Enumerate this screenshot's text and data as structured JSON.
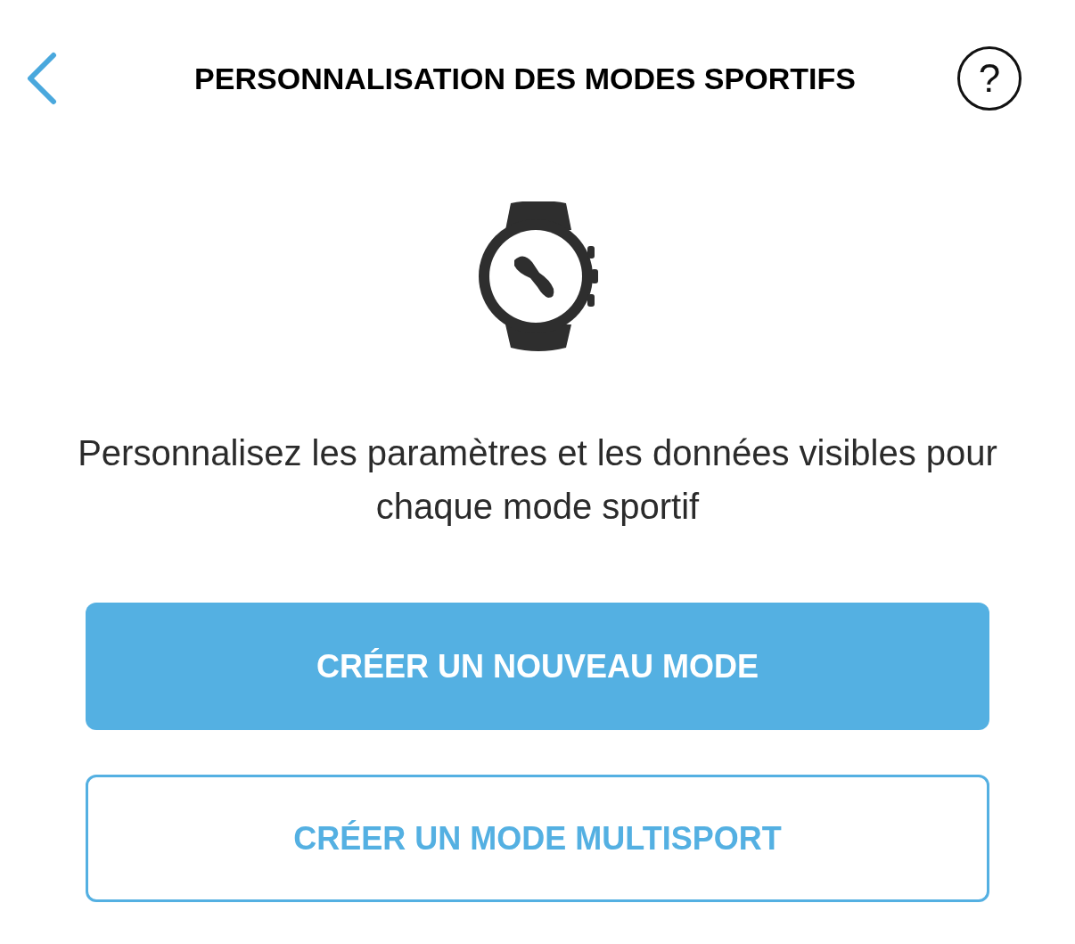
{
  "header": {
    "title": "PERSONNALISATION DES MODES SPORTIFS",
    "help": "?"
  },
  "description": "Personnalisez les paramètres et les données visibles pour chaque mode sportif",
  "buttons": [
    {
      "label": "CRÉER UN NOUVEAU MODE",
      "kind": "primary"
    },
    {
      "label": "CRÉER UN MODE MULTISPORT",
      "kind": "secondary"
    }
  ]
}
